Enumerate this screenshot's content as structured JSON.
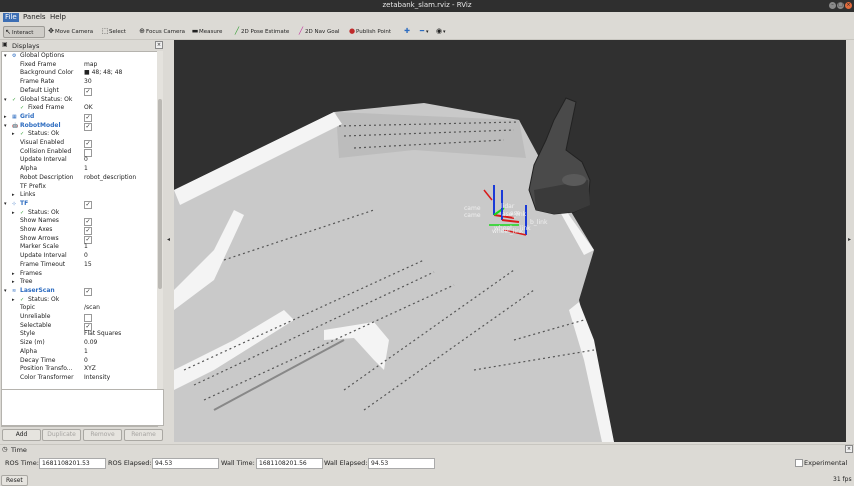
{
  "window": {
    "title": "zetabank_slam.rviz - RViz"
  },
  "menubar": [
    {
      "label": "File"
    },
    {
      "label": "Panels"
    },
    {
      "label": "Help"
    }
  ],
  "toolbar": {
    "interact": "Interact",
    "move_camera": "Move Camera",
    "select": "Select",
    "focus_camera": "Focus Camera",
    "measure": "Measure",
    "pose_estimate": "2D Pose Estimate",
    "nav_goal": "2D Nav Goal",
    "publish_point": "Publish Point"
  },
  "displays_panel": {
    "title": "Displays",
    "rows": [
      {
        "label": "Global Options",
        "value": "",
        "indent": 1,
        "expander": "▾",
        "icon": "⚙",
        "color": "#222"
      },
      {
        "label": "Fixed Frame",
        "value": "map",
        "indent": 2,
        "expander": "",
        "icon": "",
        "color": "#222"
      },
      {
        "label": "Background Color",
        "value": "■ 48; 48; 48",
        "indent": 2,
        "expander": "",
        "icon": "",
        "color": "#222"
      },
      {
        "label": "Frame Rate",
        "value": "30",
        "indent": 2,
        "expander": "",
        "icon": "",
        "color": "#222"
      },
      {
        "label": "Default Light",
        "value": "✓",
        "indent": 2,
        "expander": "",
        "icon": "",
        "color": "#222",
        "check": true
      },
      {
        "label": "Global Status: Ok",
        "value": "",
        "indent": 1,
        "expander": "▾",
        "icon": "✓",
        "color": "#222"
      },
      {
        "label": "Fixed Frame",
        "value": "OK",
        "indent": 2,
        "expander": "",
        "icon": "✓",
        "color": "#222"
      },
      {
        "label": "Grid",
        "value": "✓",
        "indent": 1,
        "expander": "▸",
        "icon": "▦",
        "color": "#2d6cc0",
        "check": true
      },
      {
        "label": "RobotModel",
        "value": "✓",
        "indent": 1,
        "expander": "▾",
        "icon": "🤖",
        "color": "#2d6cc0",
        "check": true
      },
      {
        "label": "Status: Ok",
        "value": "",
        "indent": 2,
        "expander": "▸",
        "icon": "✓",
        "color": "#222"
      },
      {
        "label": "Visual Enabled",
        "value": "✓",
        "indent": 2,
        "expander": "",
        "icon": "",
        "color": "#222",
        "check": true
      },
      {
        "label": "Collision Enabled",
        "value": "",
        "indent": 2,
        "expander": "",
        "icon": "",
        "color": "#222",
        "check": true
      },
      {
        "label": "Update Interval",
        "value": "0",
        "indent": 2,
        "expander": "",
        "icon": "",
        "color": "#222"
      },
      {
        "label": "Alpha",
        "value": "1",
        "indent": 2,
        "expander": "",
        "icon": "",
        "color": "#222"
      },
      {
        "label": "Robot Description",
        "value": "robot_description",
        "indent": 2,
        "expander": "",
        "icon": "",
        "color": "#222"
      },
      {
        "label": "TF Prefix",
        "value": "",
        "indent": 2,
        "expander": "",
        "icon": "",
        "color": "#222"
      },
      {
        "label": "Links",
        "value": "",
        "indent": 2,
        "expander": "▸",
        "icon": "",
        "color": "#222"
      },
      {
        "label": "TF",
        "value": "✓",
        "indent": 1,
        "expander": "▾",
        "icon": "⊹",
        "color": "#2d6cc0",
        "check": true
      },
      {
        "label": "Status: Ok",
        "value": "",
        "indent": 2,
        "expander": "▸",
        "icon": "✓",
        "color": "#222"
      },
      {
        "label": "Show Names",
        "value": "✓",
        "indent": 2,
        "expander": "",
        "icon": "",
        "color": "#222",
        "check": true
      },
      {
        "label": "Show Axes",
        "value": "✓",
        "indent": 2,
        "expander": "",
        "icon": "",
        "color": "#222",
        "check": true
      },
      {
        "label": "Show Arrows",
        "value": "✓",
        "indent": 2,
        "expander": "",
        "icon": "",
        "color": "#222",
        "check": true
      },
      {
        "label": "Marker Scale",
        "value": "1",
        "indent": 2,
        "expander": "",
        "icon": "",
        "color": "#222"
      },
      {
        "label": "Update Interval",
        "value": "0",
        "indent": 2,
        "expander": "",
        "icon": "",
        "color": "#222"
      },
      {
        "label": "Frame Timeout",
        "value": "15",
        "indent": 2,
        "expander": "",
        "icon": "",
        "color": "#222"
      },
      {
        "label": "Frames",
        "value": "",
        "indent": 2,
        "expander": "▸",
        "icon": "",
        "color": "#222"
      },
      {
        "label": "Tree",
        "value": "",
        "indent": 2,
        "expander": "▸",
        "icon": "",
        "color": "#222"
      },
      {
        "label": "LaserScan",
        "value": "✓",
        "indent": 1,
        "expander": "▾",
        "icon": "≋",
        "color": "#2d6cc0",
        "check": true
      },
      {
        "label": "Status: Ok",
        "value": "",
        "indent": 2,
        "expander": "▸",
        "icon": "✓",
        "color": "#222"
      },
      {
        "label": "Topic",
        "value": "/scan",
        "indent": 2,
        "expander": "",
        "icon": "",
        "color": "#222"
      },
      {
        "label": "Unreliable",
        "value": "",
        "indent": 2,
        "expander": "",
        "icon": "",
        "color": "#222",
        "check": true
      },
      {
        "label": "Selectable",
        "value": "✓",
        "indent": 2,
        "expander": "",
        "icon": "",
        "color": "#222",
        "check": true
      },
      {
        "label": "Style",
        "value": "Flat Squares",
        "indent": 2,
        "expander": "",
        "icon": "",
        "color": "#222"
      },
      {
        "label": "Size (m)",
        "value": "0.09",
        "indent": 2,
        "expander": "",
        "icon": "",
        "color": "#222"
      },
      {
        "label": "Alpha",
        "value": "1",
        "indent": 2,
        "expander": "",
        "icon": "",
        "color": "#222"
      },
      {
        "label": "Decay Time",
        "value": "0",
        "indent": 2,
        "expander": "",
        "icon": "",
        "color": "#222"
      },
      {
        "label": "Position Transfo...",
        "value": "XYZ",
        "indent": 2,
        "expander": "",
        "icon": "",
        "color": "#222"
      },
      {
        "label": "Color Transformer",
        "value": "Intensity",
        "indent": 2,
        "expander": "",
        "icon": "",
        "color": "#222"
      }
    ],
    "buttons": {
      "add": "Add",
      "duplicate": "Duplicate",
      "remove": "Remove",
      "rename": "Rename"
    }
  },
  "viewport": {
    "tf_labels": [
      "came",
      "came",
      "lidar",
      "ase",
      "ase_link",
      "b_link",
      "wheel",
      "link",
      "wheel_link"
    ]
  },
  "time_panel": {
    "title": "Time",
    "ros_time_label": "ROS Time:",
    "ros_time": "1681108201.53",
    "ros_elapsed_label": "ROS Elapsed:",
    "ros_elapsed": "94.53",
    "wall_time_label": "Wall Time:",
    "wall_time": "1681108201.56",
    "wall_elapsed_label": "Wall Elapsed:",
    "wall_elapsed": "94.53",
    "experimental": "Experimental"
  },
  "statusbar": {
    "reset": "Reset",
    "fps": "31 fps"
  }
}
